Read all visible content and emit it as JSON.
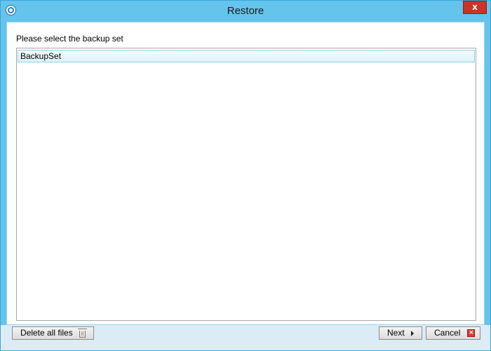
{
  "window": {
    "title": "Restore",
    "close_glyph": "x"
  },
  "content": {
    "prompt": "Please select the backup set",
    "backup_sets": [
      {
        "label": "BackupSet",
        "selected": true
      }
    ]
  },
  "footer": {
    "delete_label": "Delete all files",
    "next_label": "Next",
    "cancel_label": "Cancel",
    "cancel_glyph": "×"
  },
  "icons": {
    "app": "app-logo-icon",
    "delete": "trash-icon",
    "next": "arrow-right-icon",
    "cancel": "cancel-icon"
  },
  "colors": {
    "frame": "#64c4ec",
    "close_button": "#c7342b",
    "selection": "#def2fb",
    "footer": "#dcecf6"
  }
}
